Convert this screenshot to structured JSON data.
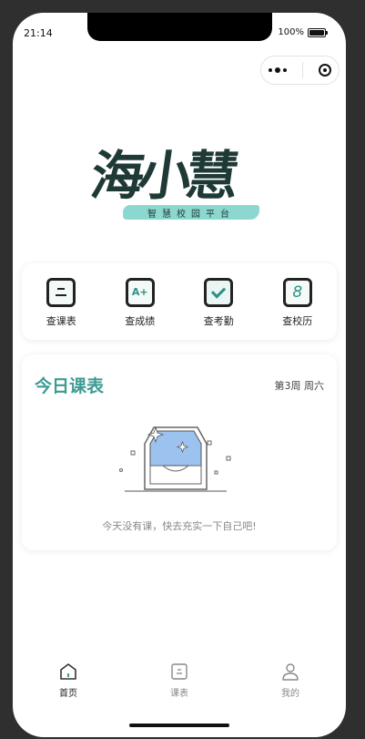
{
  "status": {
    "time": "21:14",
    "battery": "100%"
  },
  "logo": {
    "title": "海小慧",
    "subtitle": "智慧校园平台"
  },
  "quick_actions": [
    {
      "label": "查课表",
      "icon": "timetable-icon"
    },
    {
      "label": "查成绩",
      "icon": "grade-icon",
      "glyph": "A+"
    },
    {
      "label": "查考勤",
      "icon": "attendance-check-icon"
    },
    {
      "label": "查校历",
      "icon": "calendar-icon",
      "glyph": "8"
    }
  ],
  "today": {
    "title": "今日课表",
    "week": "第3周 周六",
    "empty_text": "今天没有课，快去充实一下自己吧!",
    "accent": "#3c9b93"
  },
  "tabbar": [
    {
      "label": "首页",
      "icon": "home-icon",
      "active": true
    },
    {
      "label": "课表",
      "icon": "timetable-tab-icon",
      "active": false
    },
    {
      "label": "我的",
      "icon": "profile-icon",
      "active": false
    }
  ]
}
